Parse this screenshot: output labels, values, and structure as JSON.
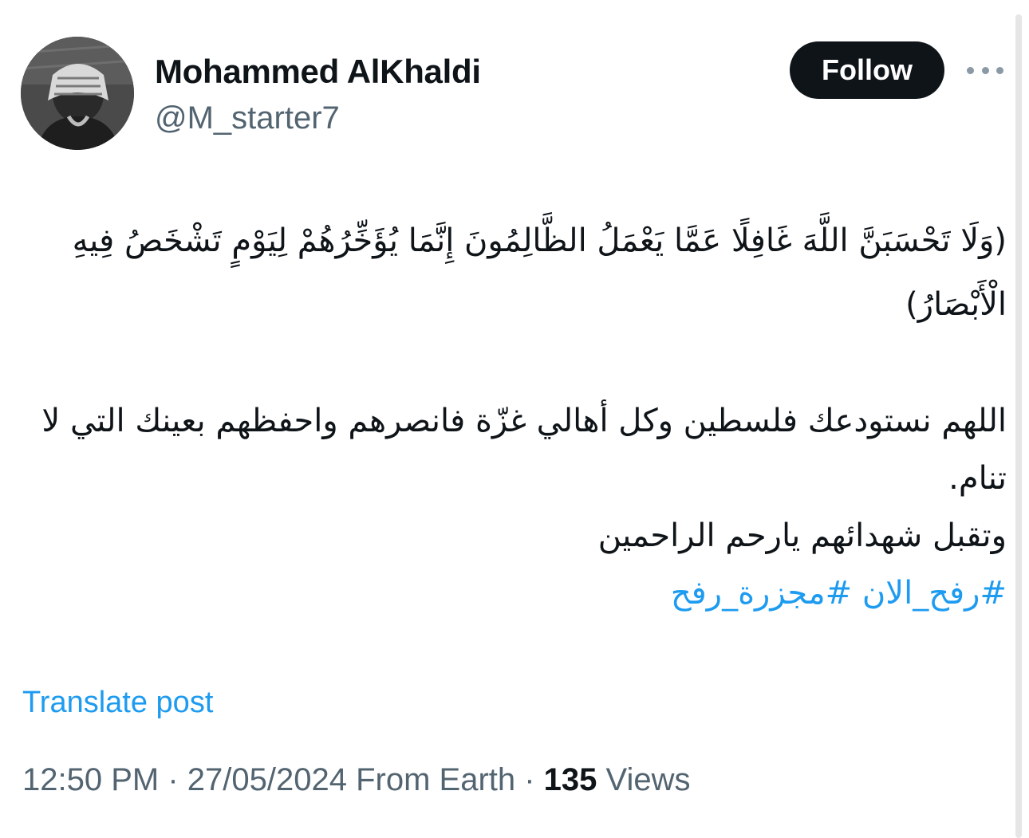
{
  "author": {
    "name": "Mohammed AlKhaldi",
    "handle": "@M_starter7"
  },
  "follow_label": "Follow",
  "icons": {
    "more": "more-horizontal-icon",
    "avatar": "profile-photo"
  },
  "post": {
    "verse": "(وَلَا تَحْسَبَنَّ اللَّهَ غَافِلًا عَمَّا يَعْمَلُ الظَّالِمُونَ إِنَّمَا يُؤَخِّرُهُمْ لِيَوْمٍ تَشْخَصُ فِيهِ الْأَبْصَارُ)",
    "prayer": "اللهم نستودعك فلسطين وكل أهالي غزّة فانصرهم واحفظهم بعينك التي لا تنام.",
    "closing": "وتقبل شهدائهم يارحم الراحمين",
    "hashtags": [
      "#رفح_الان",
      "#مجزرة_رفح"
    ]
  },
  "translate_label": "Translate post",
  "meta": {
    "time": "12:50 PM",
    "sep1": " · ",
    "date": "27/05/2024",
    "source": " From Earth",
    "sep2": " · ",
    "views_count": "135",
    "views_label": " Views"
  },
  "colors": {
    "text": "#0f1419",
    "secondary": "#536471",
    "link": "#1d9bf0",
    "button_bg": "#0f1419"
  }
}
